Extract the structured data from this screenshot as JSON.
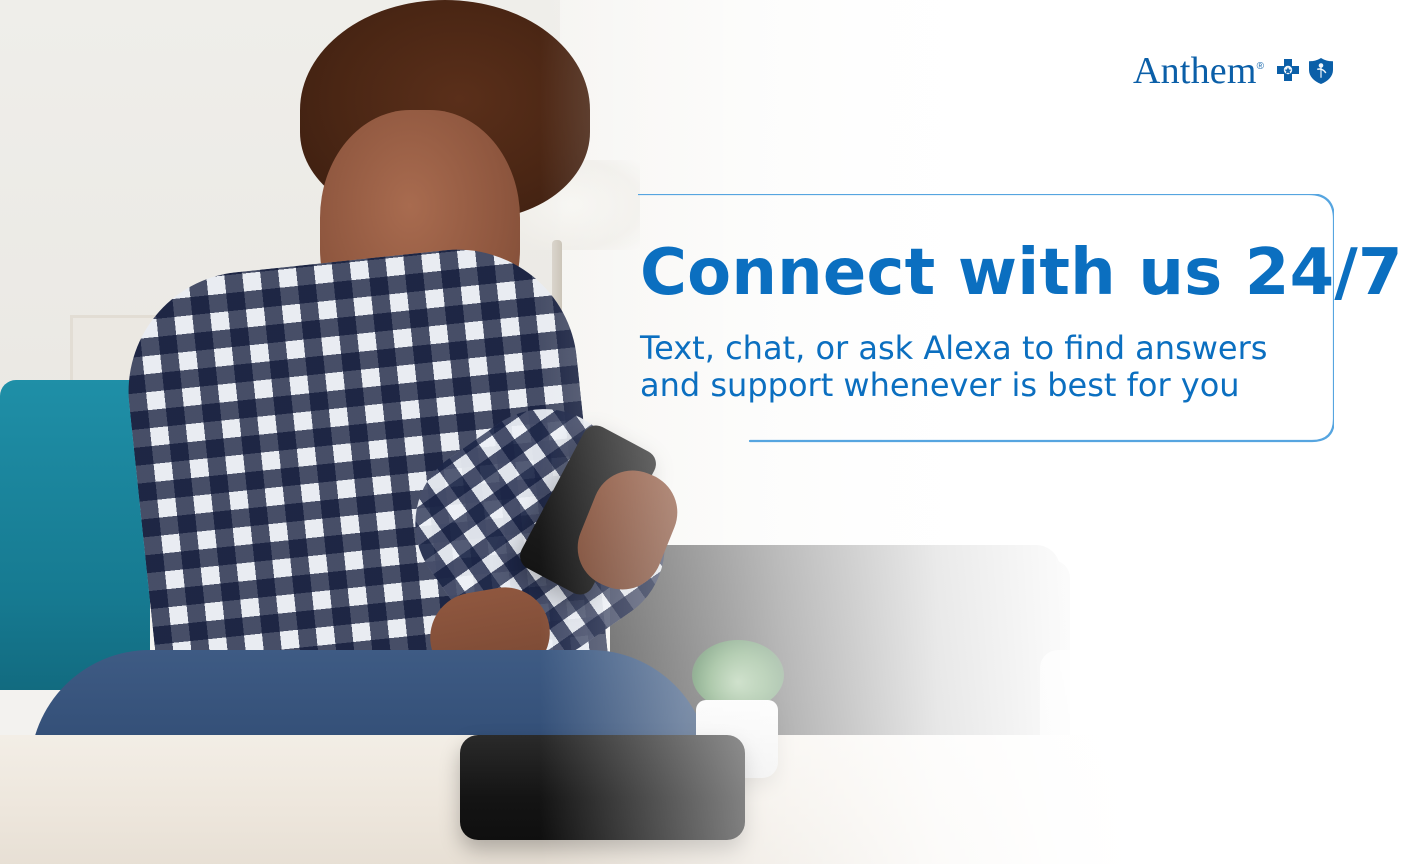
{
  "brand": {
    "name": "Anthem",
    "registered_mark": "®",
    "colors": {
      "brand_blue": "#0b5fa8",
      "headline_blue": "#0b6fc0",
      "subhead_blue": "#0b6fc0",
      "outline_blue": "#4da0de"
    },
    "icons": [
      "cross-logo-icon",
      "shield-logo-icon"
    ]
  },
  "hero": {
    "headline": "Connect with us 24/7",
    "subhead_lines": [
      "Text, chat, or ask Alexa to find answers",
      "and support whenever is best for you"
    ]
  }
}
